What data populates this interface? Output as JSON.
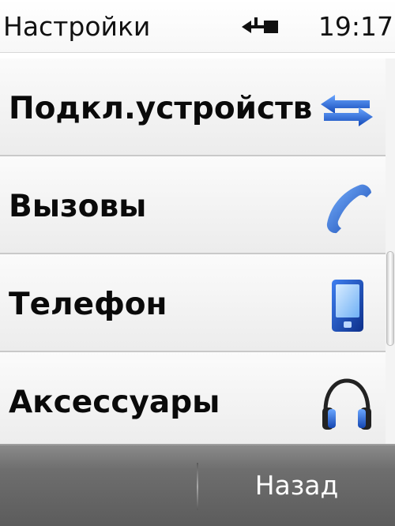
{
  "status_bar": {
    "title": "Настройки",
    "connection_icon": "usb-icon",
    "time": "19:17"
  },
  "settings_list": {
    "items": [
      {
        "label": "Подкл.устройств",
        "icon": "connectivity-arrows-icon"
      },
      {
        "label": "Вызовы",
        "icon": "phone-handset-icon"
      },
      {
        "label": "Телефон",
        "icon": "mobile-phone-icon"
      },
      {
        "label": "Аксессуары",
        "icon": "headphones-icon"
      }
    ]
  },
  "softkeys": {
    "left_label": "",
    "back_label": "Назад"
  },
  "colors": {
    "icon_blue": "#1c5fd6",
    "softkey_bar": "#6e6e6e"
  }
}
